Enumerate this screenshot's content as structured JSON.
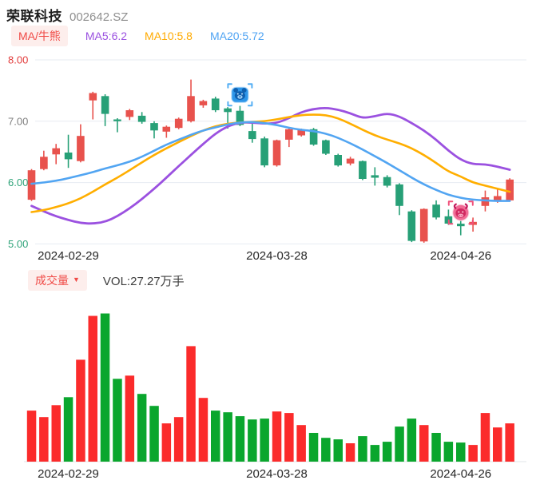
{
  "header": {
    "title": "荣联科技",
    "code": "002642.SZ"
  },
  "legend": {
    "indicator_button": "MA/牛熊",
    "items": [
      {
        "name": "ma5",
        "label": "MA5:6.2",
        "color": "#9b51e0"
      },
      {
        "name": "ma10",
        "label": "MA10:5.8",
        "color": "#ffaa00"
      },
      {
        "name": "ma20",
        "label": "MA20:5.72",
        "color": "#4ea3f3"
      }
    ]
  },
  "volume_header": {
    "button_label": "成交量",
    "caret_icon": "caret-down",
    "vol_label": "VOL:27.27万手"
  },
  "colors": {
    "accent_red": "#f04a46",
    "candle_up": "#e8524d",
    "candle_down": "#27a077",
    "vol_up": "#fb2b2b",
    "vol_down": "#0aa62d",
    "ma5": "#9b51e0",
    "ma10": "#ffae00",
    "ma20": "#52a5f2",
    "grid": "#e7ebf2",
    "baseline": "#e2e6ea",
    "date_label": "#262626",
    "bear_icon": "#2e96e9",
    "bull_icon": "#e9366b"
  },
  "chart_data": [
    {
      "type": "candlestick",
      "title": "",
      "ylim": [
        4.62,
        8.2
      ],
      "grid": true,
      "price_axis": [
        {
          "label": "8.00",
          "value": 8.0,
          "color": "#e23c3c"
        },
        {
          "label": "7.00",
          "value": 7.0,
          "color": "#808080"
        },
        {
          "label": "6.00",
          "value": 6.0,
          "color": "#2fa379"
        },
        {
          "label": "5.00",
          "value": 5.0,
          "color": "#2fa379"
        }
      ],
      "x_ticks": [
        {
          "label": "2024-02-29",
          "index": 4
        },
        {
          "label": "2024-03-28",
          "index": 21
        },
        {
          "label": "2024-04-26",
          "index": 36
        }
      ],
      "candles": [
        {
          "o": 5.72,
          "h": 6.22,
          "l": 5.7,
          "c": 6.2
        },
        {
          "o": 6.22,
          "h": 6.52,
          "l": 6.2,
          "c": 6.42
        },
        {
          "o": 6.46,
          "h": 6.63,
          "l": 6.3,
          "c": 6.56
        },
        {
          "o": 6.49,
          "h": 6.78,
          "l": 6.24,
          "c": 6.38
        },
        {
          "o": 6.35,
          "h": 6.95,
          "l": 6.33,
          "c": 6.76
        },
        {
          "o": 7.34,
          "h": 7.48,
          "l": 7.03,
          "c": 7.46
        },
        {
          "o": 7.41,
          "h": 7.44,
          "l": 6.92,
          "c": 7.12
        },
        {
          "o": 7.03,
          "h": 7.05,
          "l": 6.82,
          "c": 7.0
        },
        {
          "o": 7.07,
          "h": 7.2,
          "l": 7.02,
          "c": 7.18
        },
        {
          "o": 7.09,
          "h": 7.15,
          "l": 6.96,
          "c": 6.99
        },
        {
          "o": 6.97,
          "h": 7.0,
          "l": 6.72,
          "c": 6.85
        },
        {
          "o": 6.83,
          "h": 6.93,
          "l": 6.73,
          "c": 6.91
        },
        {
          "o": 6.89,
          "h": 7.06,
          "l": 6.87,
          "c": 7.04
        },
        {
          "o": 7.0,
          "h": 7.68,
          "l": 6.98,
          "c": 7.41
        },
        {
          "o": 7.26,
          "h": 7.35,
          "l": 7.22,
          "c": 7.33
        },
        {
          "o": 7.37,
          "h": 7.4,
          "l": 7.15,
          "c": 7.18
        },
        {
          "o": 7.21,
          "h": 7.23,
          "l": 6.88,
          "c": 7.15
        },
        {
          "o": 7.17,
          "h": 7.25,
          "l": 6.92,
          "c": 6.94
        },
        {
          "o": 6.84,
          "h": 6.97,
          "l": 6.65,
          "c": 6.71
        },
        {
          "o": 6.72,
          "h": 6.75,
          "l": 6.25,
          "c": 6.28
        },
        {
          "o": 6.28,
          "h": 6.7,
          "l": 6.26,
          "c": 6.69
        },
        {
          "o": 6.7,
          "h": 6.88,
          "l": 6.58,
          "c": 6.87
        },
        {
          "o": 6.77,
          "h": 6.88,
          "l": 6.75,
          "c": 6.86
        },
        {
          "o": 6.87,
          "h": 6.89,
          "l": 6.6,
          "c": 6.62
        },
        {
          "o": 6.69,
          "h": 6.7,
          "l": 6.45,
          "c": 6.47
        },
        {
          "o": 6.45,
          "h": 6.47,
          "l": 6.26,
          "c": 6.28
        },
        {
          "o": 6.31,
          "h": 6.42,
          "l": 6.28,
          "c": 6.39
        },
        {
          "o": 6.35,
          "h": 6.36,
          "l": 6.04,
          "c": 6.06
        },
        {
          "o": 6.12,
          "h": 6.25,
          "l": 5.95,
          "c": 6.08
        },
        {
          "o": 6.09,
          "h": 6.12,
          "l": 5.92,
          "c": 5.95
        },
        {
          "o": 5.97,
          "h": 5.99,
          "l": 5.47,
          "c": 5.62
        },
        {
          "o": 5.53,
          "h": 5.55,
          "l": 5.03,
          "c": 5.05
        },
        {
          "o": 5.04,
          "h": 5.58,
          "l": 5.02,
          "c": 5.57
        },
        {
          "o": 5.64,
          "h": 5.71,
          "l": 5.4,
          "c": 5.43
        },
        {
          "o": 5.45,
          "h": 5.56,
          "l": 5.31,
          "c": 5.33
        },
        {
          "o": 5.33,
          "h": 5.45,
          "l": 5.14,
          "c": 5.29
        },
        {
          "o": 5.31,
          "h": 5.43,
          "l": 5.2,
          "c": 5.36
        },
        {
          "o": 5.62,
          "h": 5.87,
          "l": 5.53,
          "c": 5.76
        },
        {
          "o": 5.69,
          "h": 5.89,
          "l": 5.67,
          "c": 5.78
        },
        {
          "o": 5.71,
          "h": 6.07,
          "l": 5.69,
          "c": 6.05
        }
      ],
      "series": [
        {
          "name": "MA5",
          "color_key": "ma5",
          "values": [
            5.62,
            5.53,
            5.45,
            5.39,
            5.34,
            5.33,
            5.36,
            5.45,
            5.58,
            5.73,
            5.9,
            6.08,
            6.27,
            6.45,
            6.63,
            6.8,
            6.92,
            6.98,
            6.98,
            6.96,
            6.97,
            7.05,
            7.15,
            7.2,
            7.22,
            7.19,
            7.13,
            7.05,
            7.08,
            7.13,
            7.08,
            6.97,
            6.85,
            6.7,
            6.52,
            6.37,
            6.3,
            6.3,
            6.26,
            6.21
          ]
        },
        {
          "name": "MA10",
          "color_key": "ma10",
          "values": [
            5.52,
            5.55,
            5.6,
            5.66,
            5.74,
            5.85,
            5.97,
            6.08,
            6.2,
            6.33,
            6.45,
            6.56,
            6.66,
            6.76,
            6.85,
            6.92,
            6.96,
            6.98,
            6.99,
            7.0,
            7.03,
            7.07,
            7.1,
            7.11,
            7.1,
            7.05,
            6.96,
            6.86,
            6.77,
            6.7,
            6.64,
            6.56,
            6.45,
            6.32,
            6.18,
            6.1,
            6.0,
            5.95,
            5.9,
            5.85
          ]
        },
        {
          "name": "MA20",
          "color_key": "ma20",
          "values": [
            5.98,
            6.0,
            6.03,
            6.07,
            6.12,
            6.17,
            6.23,
            6.28,
            6.34,
            6.42,
            6.52,
            6.62,
            6.7,
            6.78,
            6.85,
            6.9,
            6.95,
            6.98,
            6.99,
            6.97,
            6.94,
            6.89,
            6.86,
            6.84,
            6.8,
            6.73,
            6.64,
            6.54,
            6.43,
            6.32,
            6.2,
            6.08,
            5.97,
            5.88,
            5.8,
            5.75,
            5.72,
            5.71,
            5.7,
            5.7
          ]
        }
      ],
      "markers": [
        {
          "kind": "bear",
          "index": 18,
          "price": 7.43
        },
        {
          "kind": "bull",
          "index": 36,
          "price": 5.51
        }
      ]
    },
    {
      "type": "bar",
      "name": "volume",
      "unit": "万手",
      "ylim": [
        0,
        110
      ],
      "values": [
        36.4,
        31.8,
        40.3,
        46.0,
        72.7,
        104.0,
        105.7,
        59.1,
        61.4,
        48.3,
        39.8,
        27.3,
        31.8,
        82.4,
        45.5,
        36.4,
        35.2,
        32.4,
        30.1,
        30.7,
        35.8,
        34.7,
        26.1,
        20.5,
        17.0,
        15.9,
        13.1,
        18.2,
        11.9,
        14.2,
        25.0,
        30.7,
        26.1,
        20.5,
        14.2,
        13.6,
        11.9,
        34.7,
        24.4,
        27.3
      ],
      "x_ticks": [
        {
          "label": "2024-02-29",
          "index": 4
        },
        {
          "label": "2024-03-28",
          "index": 21
        },
        {
          "label": "2024-04-26",
          "index": 36
        }
      ]
    }
  ]
}
